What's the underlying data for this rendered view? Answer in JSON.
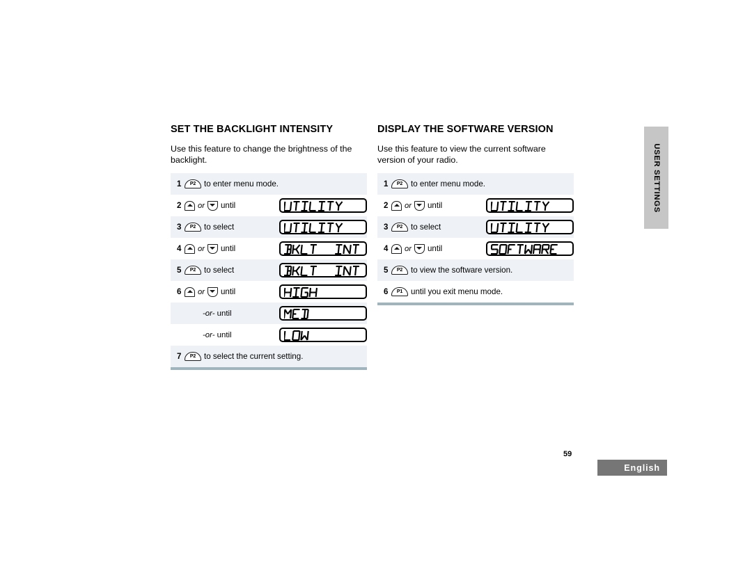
{
  "page": {
    "number": "59",
    "language": "English",
    "side_tab": "USER SETTINGS"
  },
  "sections": [
    {
      "title": "SET THE BACKLIGHT INTENSITY",
      "intro": "Use this feature to change the brightness of the backlight.",
      "steps": [
        {
          "num": "1",
          "button": "P2",
          "button_type": "pill",
          "text": "to enter menu mode.",
          "lcd": ""
        },
        {
          "num": "2",
          "button": "",
          "button_type": "arrows",
          "or_label": "or",
          "text": "until",
          "lcd": "UTILITY"
        },
        {
          "num": "3",
          "button": "P2",
          "button_type": "pill",
          "text": "to select",
          "lcd": "UTILITY"
        },
        {
          "num": "4",
          "button": "",
          "button_type": "arrows",
          "or_label": "or",
          "text": "until",
          "lcd": "BKLT  INT"
        },
        {
          "num": "5",
          "button": "P2",
          "button_type": "pill",
          "text": "to select",
          "lcd": "BKLT  INT"
        },
        {
          "num": "6",
          "button": "",
          "button_type": "arrows",
          "or_label": "or",
          "text": "until",
          "lcd": "HIGH"
        },
        {
          "num": "",
          "button_type": "or-until",
          "or_text": "-or- until",
          "lcd": "MED"
        },
        {
          "num": "",
          "button_type": "or-until",
          "or_text": "-or- until",
          "lcd": "LOW"
        },
        {
          "num": "7",
          "button": "P2",
          "button_type": "pill",
          "text": "to select the current setting.",
          "lcd": ""
        }
      ]
    },
    {
      "title": "DISPLAY THE SOFTWARE VERSION",
      "intro": "Use this feature to view the current software version of your radio.",
      "steps": [
        {
          "num": "1",
          "button": "P2",
          "button_type": "pill",
          "text": "to enter menu mode.",
          "lcd": ""
        },
        {
          "num": "2",
          "button": "",
          "button_type": "arrows",
          "or_label": "or",
          "text": "until",
          "lcd": "UTILITY"
        },
        {
          "num": "3",
          "button": "P2",
          "button_type": "pill",
          "text": "to select",
          "lcd": "UTILITY"
        },
        {
          "num": "4",
          "button": "",
          "button_type": "arrows",
          "or_label": "or",
          "text": "until",
          "lcd": "SOFTWARE"
        },
        {
          "num": "5",
          "button": "P2",
          "button_type": "pill",
          "text": "to view the software version.",
          "lcd": ""
        },
        {
          "num": "6",
          "button": "P1",
          "button_type": "pill",
          "text": "until you exit menu mode.",
          "lcd": ""
        }
      ]
    }
  ],
  "colors": {
    "row_shade": "#eef2f6",
    "rule": "#9fb4bd",
    "side_tab": "#c6c6c6",
    "lang_box": "#767676"
  }
}
